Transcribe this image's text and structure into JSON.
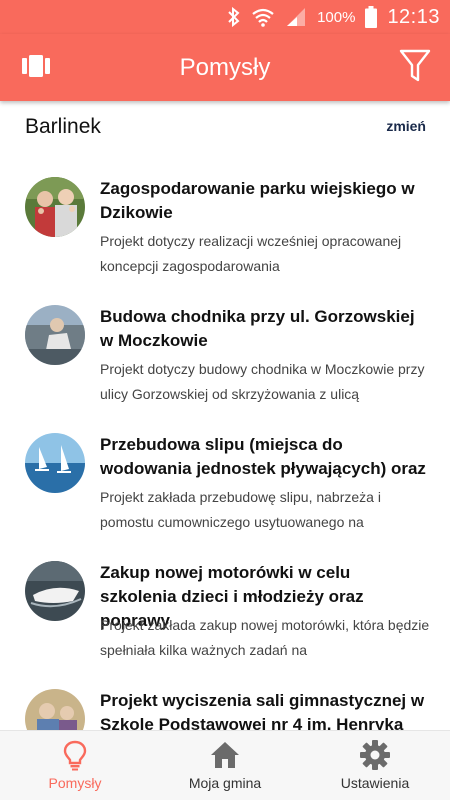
{
  "status_bar": {
    "battery_percent": "100%",
    "time": "12:13",
    "icons": [
      "bluetooth-icon",
      "wifi-icon",
      "signal-icon",
      "battery-icon"
    ]
  },
  "app_bar": {
    "title": "Pomysły",
    "left_icon": "cards-icon",
    "right_icon": "filter-icon"
  },
  "location": {
    "name": "Barlinek",
    "change_label": "zmień"
  },
  "ideas": [
    {
      "title": "Zagospodarowanie parku wiejskiego w Dzikowie",
      "description": "Projekt dotyczy realizacji wcześniej opracowanej koncepcji zagospodarowania"
    },
    {
      "title": "Budowa chodnika przy ul. Gorzowskiej w Moczkowie",
      "description": "Projekt dotyczy budowy chodnika w Moczkowie przy ulicy Gorzowskiej od skrzyżowania z ulicą"
    },
    {
      "title": "Przebudowa slipu (miejsca do wodowania jednostek pływających) oraz",
      "description": "Projekt zakłada przebudowę slipu, nabrzeża i pomostu cumowniczego usytuowanego na"
    },
    {
      "title": "Zakup nowej motorówki w celu szkolenia dzieci i młodzieży oraz poprawy",
      "description": "Projekt zakłada zakup nowej motorówki, która będzie spełniała kilka ważnych zadań na"
    },
    {
      "title": "Projekt wyciszenia sali gimnastycznej w Szkole Podstawowej nr 4 im. Henryka",
      "description": ""
    }
  ],
  "bottom_nav": [
    {
      "label": "Pomysły",
      "icon": "lightbulb-icon",
      "active": true
    },
    {
      "label": "Moja gmina",
      "icon": "home-icon",
      "active": false
    },
    {
      "label": "Ustawienia",
      "icon": "gear-icon",
      "active": false
    }
  ],
  "colors": {
    "primary": "#f96a5c",
    "nav_background": "#f7f7f7"
  }
}
